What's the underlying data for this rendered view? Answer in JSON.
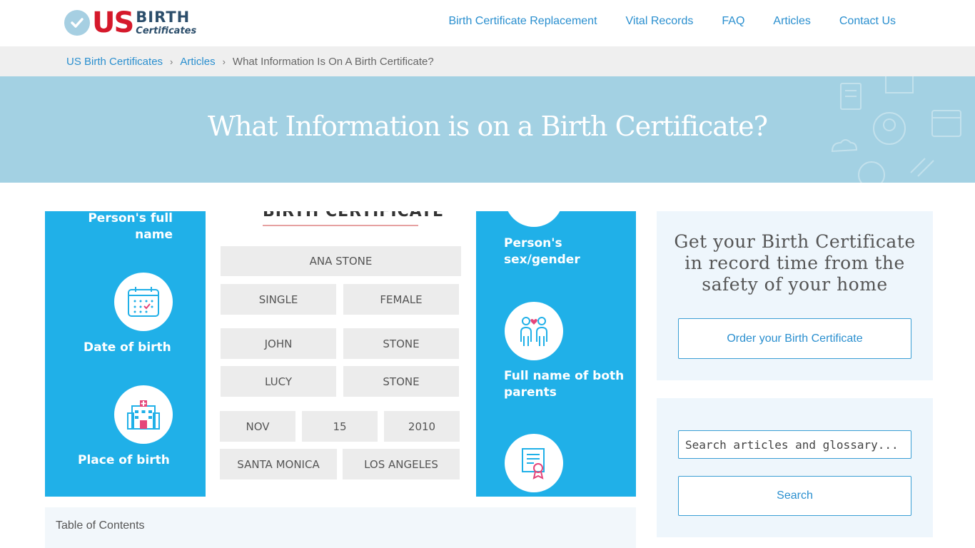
{
  "header": {
    "logo": {
      "us": "US",
      "birth": "BIRTH",
      "certificates": "Certificates"
    },
    "nav": [
      "Birth Certificate Replacement",
      "Vital Records",
      "FAQ",
      "Articles",
      "Contact Us"
    ]
  },
  "breadcrumb": {
    "home": "US Birth Certificates",
    "articles": "Articles",
    "current": "What Information Is On A Birth Certificate?",
    "separator": "›"
  },
  "hero": {
    "title": "What Information is on a Birth Certificate?"
  },
  "infographic": {
    "left_labels": [
      "Person's full name",
      "Date of birth",
      "Place of birth"
    ],
    "right_labels": [
      "Person's sex/gender",
      "Full name of both parents"
    ],
    "certificate_title": "BIRTH CERTIFICATE",
    "fields": {
      "full_name": "ANA STONE",
      "status": "SINGLE",
      "gender": "FEMALE",
      "father_first": "JOHN",
      "father_last": "STONE",
      "mother_first": "LUCY",
      "mother_last": "STONE",
      "month": "NOV",
      "day": "15",
      "year": "2010",
      "city": "SANTA MONICA",
      "county": "LOS ANGELES"
    },
    "colors": {
      "panel": "#20b0e8",
      "field": "#ececec"
    }
  },
  "toc": {
    "label": "Table of Contents"
  },
  "sidebar": {
    "promo_heading": "Get your Birth Certificate in record time from the safety of your home",
    "order_button": "Order your Birth Certificate",
    "search_placeholder": "Search articles and glossary...",
    "search_button": "Search"
  },
  "icons": [
    "check-icon",
    "calendar-icon",
    "hospital-icon",
    "gender-icon",
    "parents-icon",
    "certificate-icon"
  ],
  "colors": {
    "accent": "#2a8fcf",
    "brand_red": "#d5192b",
    "hero": "#a3d1e3"
  }
}
